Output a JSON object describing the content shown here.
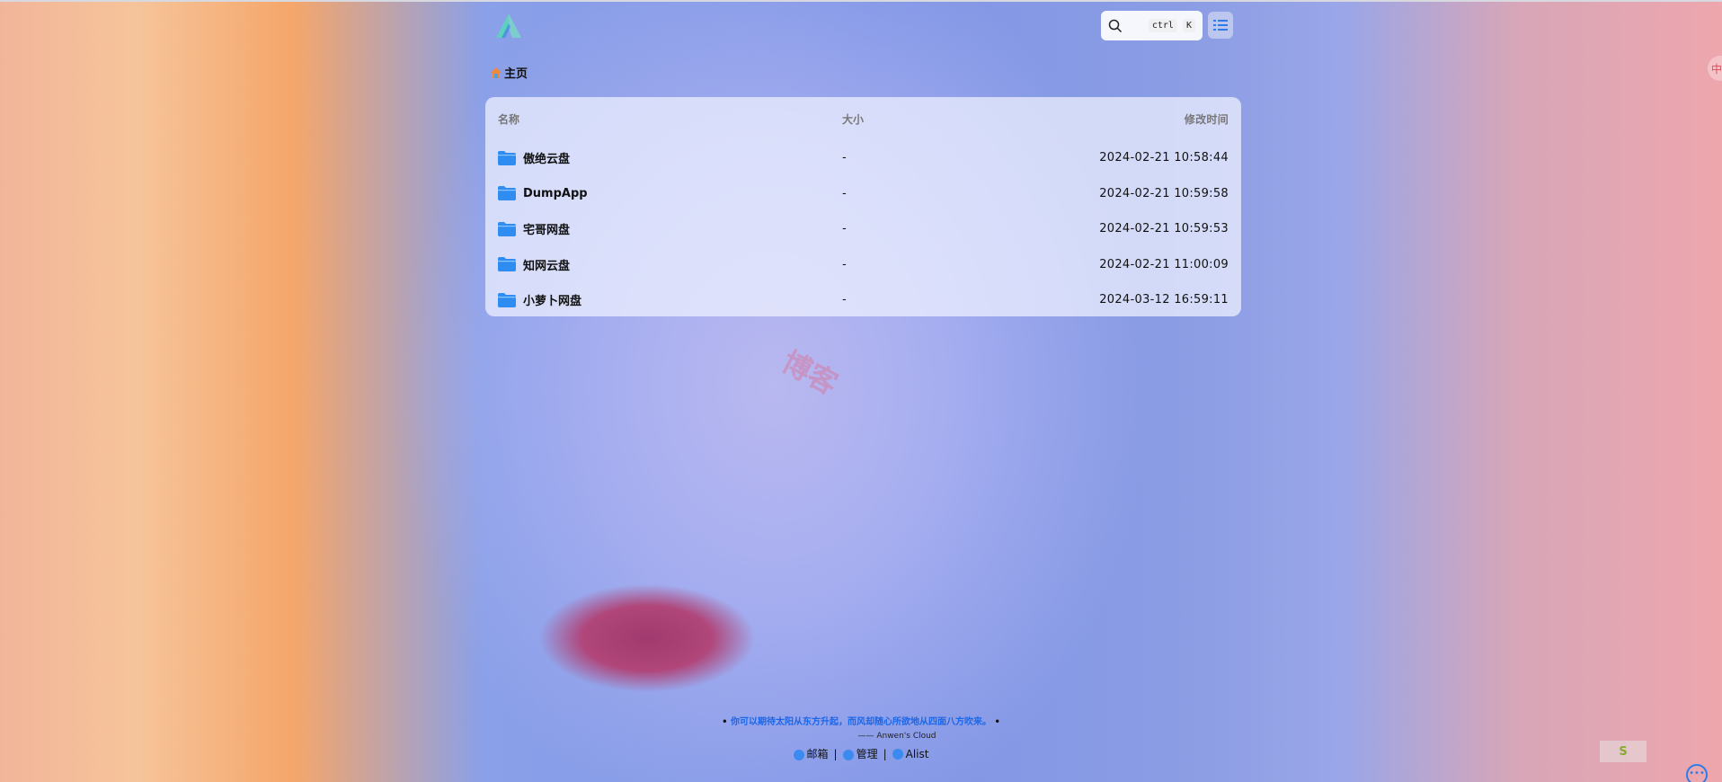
{
  "header": {
    "search_kbd": [
      "ctrl",
      "K"
    ]
  },
  "breadcrumb": {
    "home_label": "主页"
  },
  "table": {
    "columns": [
      "名称",
      "大小",
      "修改时间"
    ],
    "rows": [
      {
        "name": "傲绝云盘",
        "size": "-",
        "modified": "2024-02-21 10:58:44"
      },
      {
        "name": "DumpApp",
        "size": "-",
        "modified": "2024-02-21 10:59:58"
      },
      {
        "name": "宅哥网盘",
        "size": "-",
        "modified": "2024-02-21 10:59:53"
      },
      {
        "name": "知网云盘",
        "size": "-",
        "modified": "2024-02-21 11:00:09"
      },
      {
        "name": "小萝卜网盘",
        "size": "-",
        "modified": "2024-03-12 16:59:11"
      }
    ]
  },
  "footer": {
    "quote": "你可以期待太阳从东方升起，而风却随心所欲地从四面八方吹来。",
    "attribution": "—— Anwen's Cloud",
    "links": [
      "邮箱",
      "管理",
      "Alist"
    ]
  },
  "side": {
    "lang_badge": "中",
    "more": "•••",
    "s_icon": "S"
  },
  "colors": {
    "accent": "#1a66e8",
    "folder": "#2f8cf0"
  }
}
